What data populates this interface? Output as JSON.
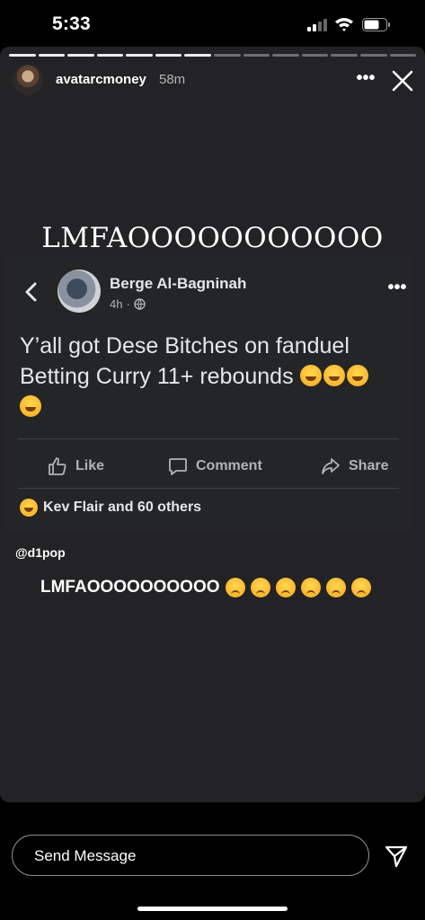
{
  "status_bar": {
    "time": "5:33"
  },
  "story": {
    "progress_segments_total": 14,
    "progress_segments_done": 7,
    "username": "avatarcmoney",
    "time_ago": "58m",
    "more_label": "•••",
    "caption": "LMFAOOOOOOOOOOO"
  },
  "post": {
    "author": "Berge Al-Bagninah",
    "time": "4h",
    "more_label": "•••",
    "text_line1": "Y’all got Dese Bitches on fanduel",
    "text_line2": "Betting Curry 11+ rebounds",
    "like_label": "Like",
    "comment_label": "Comment",
    "share_label": "Share",
    "reactions_text": "Kev Flair  and 60 others"
  },
  "mention": "@d1pop",
  "sticker_text": "LMFAOOOOOOOOOO",
  "message_input": {
    "placeholder": "Send Message"
  },
  "icons": {
    "laugh_emoji": "rolling-on-floor-laughing",
    "sad_emoji": "disappointed-face",
    "globe": "globe-icon"
  }
}
